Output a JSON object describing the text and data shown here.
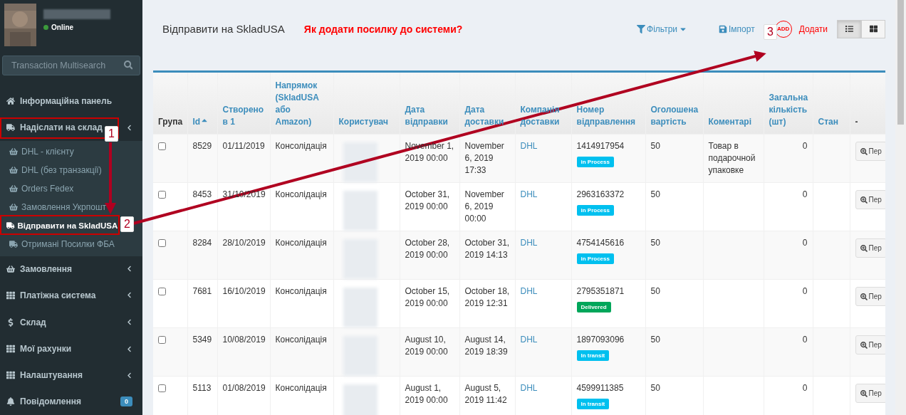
{
  "user": {
    "status": "Online"
  },
  "search": {
    "placeholder": "Transaction Multisearch"
  },
  "sidebar": {
    "items": [
      {
        "label": "Інформаційна панель",
        "selected": false,
        "expandable": false
      },
      {
        "label": "Надіслати на склад",
        "selected": false,
        "expandable": true,
        "expanded": true,
        "children": [
          {
            "label": "DHL - клієнту",
            "selected": false
          },
          {
            "label": "DHL (без транзакції)",
            "selected": false
          },
          {
            "label": "Orders Fedex",
            "selected": false
          },
          {
            "label": "Замовлення Укрпошт",
            "selected": false
          },
          {
            "label": "Відправити на SkladUSA",
            "selected": true
          },
          {
            "label": "Отримані Посилки ФБА",
            "selected": false
          }
        ]
      },
      {
        "label": "Замовлення",
        "selected": false,
        "expandable": true
      },
      {
        "label": "Платіжна система",
        "selected": false,
        "expandable": true
      },
      {
        "label": "Склад",
        "selected": false,
        "expandable": true
      },
      {
        "label": "Мої рахунки",
        "selected": false,
        "expandable": true
      },
      {
        "label": "Налаштування",
        "selected": false,
        "expandable": true
      },
      {
        "label": "Повідомлення",
        "selected": false,
        "expandable": false,
        "badge": "0"
      }
    ]
  },
  "header": {
    "title": "Відправити на SkladUSA",
    "help_link": "Як додати посилку до системи?",
    "filters": "Фільтри",
    "import": "Імпорт",
    "add_icon_text": "ADD",
    "add": "Додати",
    "views": [
      {
        "kind": "list",
        "selected": true
      },
      {
        "kind": "grid",
        "selected": false
      }
    ]
  },
  "table": {
    "columns": [
      {
        "label": "Група",
        "sortable": false,
        "sorted": false
      },
      {
        "label": "Id",
        "sortable": true,
        "sorted": true
      },
      {
        "label": "Створено в 1",
        "sortable": true,
        "sorted": false
      },
      {
        "label": "Напрямок (SkladUSA або Amazon)",
        "sortable": true,
        "sorted": false
      },
      {
        "label": "Користувач",
        "sortable": true,
        "sorted": false
      },
      {
        "label": "Дата відправки",
        "sortable": true,
        "sorted": false
      },
      {
        "label": "Дата доставки",
        "sortable": true,
        "sorted": false
      },
      {
        "label": "Компанія доставки",
        "sortable": true,
        "sorted": false
      },
      {
        "label": "Номер відправлення",
        "sortable": true,
        "sorted": false
      },
      {
        "label": "Оголошена вартість",
        "sortable": true,
        "sorted": false
      },
      {
        "label": "Коментарі",
        "sortable": true,
        "sorted": false
      },
      {
        "label": "Загальна кількість (шт)",
        "sortable": true,
        "sorted": false
      },
      {
        "label": "Стан",
        "sortable": true,
        "sorted": false
      },
      {
        "label": "-",
        "sortable": false,
        "sorted": false
      }
    ],
    "rows": [
      {
        "checked": false,
        "id": "8529",
        "created": "01/11/2019",
        "direction": "Консолідація",
        "sent": "November 1, 2019 00:00",
        "delivered": "November 6, 2019 17:33",
        "company": "DHL",
        "tracking": "1414917954",
        "status": {
          "label": "in Process",
          "color": "#00c0ef"
        },
        "value": "50",
        "comment": "Товар в подарочной упаковке",
        "quantity": "0",
        "action": "Пер"
      },
      {
        "checked": false,
        "id": "8453",
        "created": "31/10/2019",
        "direction": "Консолідація",
        "sent": "October 31, 2019 00:00",
        "delivered": "November 6, 2019 00:00",
        "company": "DHL",
        "tracking": "2963163372",
        "status": {
          "label": "in Process",
          "color": "#00c0ef"
        },
        "value": "50",
        "quantity": "0",
        "action": "Пер"
      },
      {
        "checked": false,
        "id": "8284",
        "created": "28/10/2019",
        "direction": "Консолідація",
        "sent": "October 28, 2019 00:00",
        "delivered": "October 31, 2019 14:13",
        "company": "DHL",
        "tracking": "4754145616",
        "status": {
          "label": "in Process",
          "color": "#00c0ef"
        },
        "value": "50",
        "quantity": "0",
        "action": "Пер"
      },
      {
        "checked": false,
        "id": "7681",
        "created": "16/10/2019",
        "direction": "Консолідація",
        "sent": "October 15, 2019 00:00",
        "delivered": "October 18, 2019 12:31",
        "company": "DHL",
        "tracking": "2795351871",
        "status": {
          "label": "Delivered",
          "color": "#00a65a"
        },
        "value": "50",
        "quantity": "0",
        "action": "Пер"
      },
      {
        "checked": false,
        "id": "5349",
        "created": "10/08/2019",
        "direction": "Консолідація",
        "sent": "August 10, 2019 00:00",
        "delivered": "August 14, 2019 18:39",
        "company": "DHL",
        "tracking": "1897093096",
        "status": {
          "label": "In transit",
          "color": "#00c0ef"
        },
        "value": "50",
        "quantity": "0",
        "action": "Пер"
      },
      {
        "checked": false,
        "id": "5113",
        "created": "01/08/2019",
        "direction": "Консолідація",
        "sent": "August 1, 2019 00:00",
        "delivered": "August 5, 2019 11:42",
        "company": "DHL",
        "tracking": "4599911385",
        "status": {
          "label": "In transit",
          "color": "#00c0ef"
        },
        "value": "50",
        "quantity": "0",
        "action": "Пер"
      }
    ]
  },
  "annotations": [
    {
      "label": "1"
    },
    {
      "label": "2"
    },
    {
      "label": "3"
    }
  ]
}
